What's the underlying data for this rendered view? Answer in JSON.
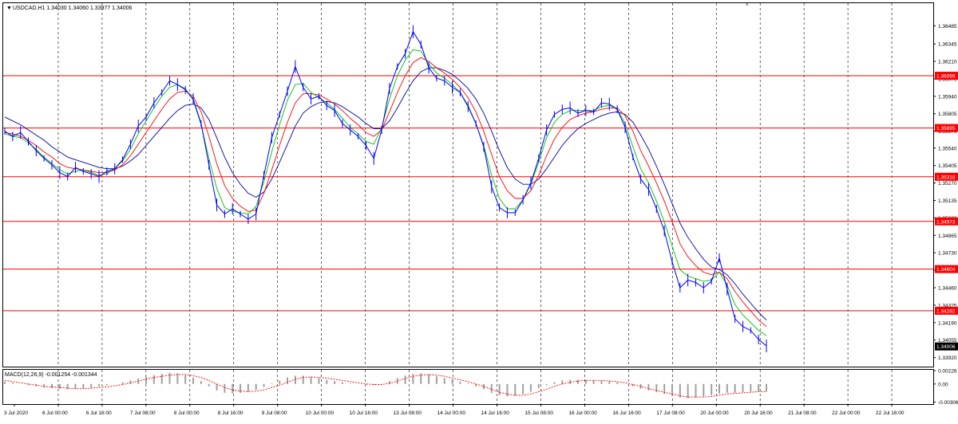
{
  "header": {
    "symbol_line": "USDCAD,H1  1.34030 1.34060 1.33977 1.34006",
    "indicator_label": "MACD(12,26,9) -0.001254 -0.001344"
  },
  "colors": {
    "price": "#0000ff",
    "ma_fast": "#00c000",
    "ma_mid": "#ff0000",
    "ma_slow": "#0000a0",
    "level_line": "#ff0000",
    "level_tag": "#ff0000",
    "current_tag": "#000000",
    "grid": "#000000",
    "macd_hist": "#a0a0a0",
    "macd_signal": "#ff0000"
  },
  "chart_data": [
    {
      "type": "line",
      "name_hint": "price",
      "ylim": [
        1.3385,
        1.3666
      ],
      "y_ticks": [
        1.36485,
        1.36345,
        1.3621,
        1.36075,
        1.3594,
        1.35805,
        1.3567,
        1.3554,
        1.35405,
        1.3527,
        1.35135,
        1.35,
        1.34865,
        1.3473,
        1.34595,
        1.3446,
        1.34325,
        1.3419,
        1.34055,
        1.3392
      ],
      "y_tick_labels": [
        "1.36485",
        "1.36345",
        "1.36210",
        "1.36075",
        "1.35940",
        "1.35805",
        "1.35670",
        "1.35540",
        "1.35405",
        "1.35270",
        "1.35135",
        "1.35000",
        "1.34865",
        "1.34730",
        "1.34595",
        "1.34460",
        "1.34325",
        "1.34190",
        "1.34055",
        "1.33920"
      ],
      "x_labels": [
        "3 Jul 2020",
        "6 Jul 00:00",
        "6 Jul 16:00",
        "7 Jul 08:00",
        "8 Jul 00:00",
        "8 Jul 16:00",
        "9 Jul 08:00",
        "10 Jul 00:00",
        "10 Jul 16:00",
        "13 Jul 08:00",
        "14 Jul 00:00",
        "14 Jul 16:00",
        "15 Jul 08:00",
        "16 Jul 00:00",
        "16 Jul 16:00",
        "17 Jul 08:00",
        "20 Jul 00:00",
        "20 Jul 16:00",
        "21 Jul 08:00",
        "22 Jul 00:00",
        "22 Jul 16:00"
      ],
      "levels": [
        {
          "value": 1.36099,
          "label": "1.36099"
        },
        {
          "value": 1.35695,
          "label": "1.35695"
        },
        {
          "value": 1.35318,
          "label": "1.35318"
        },
        {
          "value": 1.34973,
          "label": "1.34973"
        },
        {
          "value": 1.34604,
          "label": "1.34604"
        },
        {
          "value": 1.34282,
          "label": "1.34282"
        }
      ],
      "current_price": {
        "value": 1.34006,
        "label": "1.34006"
      },
      "price_series": [
        1.3567,
        1.3563,
        1.3566,
        1.3559,
        1.3552,
        1.3546,
        1.3541,
        1.3535,
        1.3532,
        1.3539,
        1.3536,
        1.3534,
        1.3532,
        1.3536,
        1.3538,
        1.3545,
        1.3557,
        1.3571,
        1.3578,
        1.3589,
        1.3597,
        1.3606,
        1.3603,
        1.3599,
        1.3592,
        1.3573,
        1.3541,
        1.351,
        1.3503,
        1.3507,
        1.3503,
        1.3499,
        1.3503,
        1.3533,
        1.3562,
        1.358,
        1.3598,
        1.3617,
        1.3601,
        1.3592,
        1.3594,
        1.3587,
        1.3583,
        1.3573,
        1.3568,
        1.3563,
        1.3556,
        1.3546,
        1.3568,
        1.36,
        1.3617,
        1.3627,
        1.3644,
        1.3634,
        1.3616,
        1.3608,
        1.3606,
        1.3601,
        1.3597,
        1.3586,
        1.3573,
        1.3555,
        1.3524,
        1.3508,
        1.3504,
        1.3504,
        1.3514,
        1.3527,
        1.3546,
        1.3568,
        1.358,
        1.3584,
        1.3585,
        1.3581,
        1.3583,
        1.3582,
        1.3589,
        1.3588,
        1.3584,
        1.357,
        1.3547,
        1.353,
        1.3522,
        1.3507,
        1.349,
        1.3466,
        1.3446,
        1.3452,
        1.345,
        1.3446,
        1.3451,
        1.3469,
        1.3445,
        1.3422,
        1.3416,
        1.3413,
        1.3406,
        1.3401
      ],
      "ma_fast_series": [
        1.3565,
        1.3563,
        1.3562,
        1.3558,
        1.3553,
        1.3547,
        1.3542,
        1.3537,
        1.3534,
        1.3536,
        1.3537,
        1.3535,
        1.3533,
        1.3534,
        1.3538,
        1.3544,
        1.3553,
        1.3565,
        1.3575,
        1.3585,
        1.3594,
        1.3601,
        1.3603,
        1.36,
        1.3591,
        1.3572,
        1.3546,
        1.3523,
        1.3508,
        1.3505,
        1.3504,
        1.3503,
        1.3509,
        1.3528,
        1.3551,
        1.3572,
        1.3591,
        1.3603,
        1.3604,
        1.3597,
        1.3593,
        1.3589,
        1.3584,
        1.3577,
        1.357,
        1.3565,
        1.3559,
        1.3557,
        1.357,
        1.3592,
        1.361,
        1.3622,
        1.363,
        1.3629,
        1.3619,
        1.3612,
        1.3608,
        1.3603,
        1.3597,
        1.3587,
        1.3573,
        1.3556,
        1.3533,
        1.3515,
        1.3507,
        1.3507,
        1.3514,
        1.3526,
        1.3543,
        1.3562,
        1.3574,
        1.358,
        1.3583,
        1.3583,
        1.3583,
        1.3583,
        1.3586,
        1.3587,
        1.3584,
        1.3573,
        1.3555,
        1.3538,
        1.3527,
        1.3513,
        1.3497,
        1.3478,
        1.346,
        1.3455,
        1.3453,
        1.3451,
        1.3452,
        1.3458,
        1.3448,
        1.3433,
        1.3425,
        1.3419,
        1.3413,
        1.3409
      ],
      "ma_mid_series": [
        1.3566,
        1.3565,
        1.3563,
        1.356,
        1.3556,
        1.3551,
        1.3547,
        1.3542,
        1.3539,
        1.3538,
        1.3537,
        1.3536,
        1.3535,
        1.3535,
        1.3537,
        1.3541,
        1.3548,
        1.3557,
        1.3566,
        1.3575,
        1.3584,
        1.3592,
        1.3597,
        1.3598,
        1.3594,
        1.3582,
        1.3563,
        1.3542,
        1.3525,
        1.3515,
        1.3509,
        1.3505,
        1.3506,
        1.3519,
        1.3537,
        1.3556,
        1.3574,
        1.3589,
        1.3596,
        1.3596,
        1.3595,
        1.3592,
        1.3588,
        1.3583,
        1.3577,
        1.3572,
        1.3566,
        1.3563,
        1.3568,
        1.3582,
        1.3597,
        1.361,
        1.362,
        1.3624,
        1.3621,
        1.3616,
        1.3612,
        1.3607,
        1.3601,
        1.3593,
        1.3582,
        1.3567,
        1.3549,
        1.3532,
        1.3521,
        1.3515,
        1.3515,
        1.3521,
        1.3533,
        1.3548,
        1.3561,
        1.357,
        1.3576,
        1.3579,
        1.3581,
        1.3582,
        1.3584,
        1.3585,
        1.3585,
        1.3579,
        1.3567,
        1.3552,
        1.354,
        1.3527,
        1.3513,
        1.3497,
        1.348,
        1.347,
        1.3463,
        1.3458,
        1.3456,
        1.3458,
        1.3453,
        1.3443,
        1.3435,
        1.3428,
        1.3421,
        1.3416
      ],
      "ma_slow_series": [
        1.3578,
        1.3575,
        1.3572,
        1.3568,
        1.3564,
        1.356,
        1.3555,
        1.3551,
        1.3547,
        1.3545,
        1.3543,
        1.3541,
        1.3539,
        1.3538,
        1.3538,
        1.354,
        1.3544,
        1.3549,
        1.3556,
        1.3563,
        1.357,
        1.3577,
        1.3583,
        1.3587,
        1.3588,
        1.3585,
        1.3576,
        1.3562,
        1.3547,
        1.3535,
        1.3526,
        1.3519,
        1.3516,
        1.352,
        1.353,
        1.3543,
        1.3557,
        1.3571,
        1.3581,
        1.3586,
        1.3589,
        1.359,
        1.3589,
        1.3586,
        1.3582,
        1.3578,
        1.3573,
        1.3569,
        1.3569,
        1.3575,
        1.3585,
        1.3596,
        1.3606,
        1.3613,
        1.3616,
        1.3616,
        1.3614,
        1.3611,
        1.3606,
        1.36,
        1.3592,
        1.3581,
        1.3567,
        1.3552,
        1.3539,
        1.353,
        1.3526,
        1.3526,
        1.353,
        1.3538,
        1.3547,
        1.3556,
        1.3563,
        1.3569,
        1.3573,
        1.3576,
        1.3579,
        1.3581,
        1.3582,
        1.358,
        1.3574,
        1.3564,
        1.3553,
        1.354,
        1.3526,
        1.3511,
        1.3496,
        1.3485,
        1.3476,
        1.3468,
        1.3462,
        1.346,
        1.3456,
        1.3449,
        1.3441,
        1.3434,
        1.3427,
        1.3421
      ]
    },
    {
      "type": "bar",
      "name_hint": "MACD",
      "ylim": [
        -0.0034,
        0.0024
      ],
      "y_ticks": [
        0.00226,
        0.0,
        -0.00306
      ],
      "y_tick_labels": [
        "0.00226",
        "0.00",
        "-0.00306"
      ],
      "hist_series": [
        0.0004,
        0.0002,
        0.0,
        -0.0002,
        -0.0004,
        -0.0006,
        -0.0007,
        -0.0008,
        -0.0009,
        -0.0008,
        -0.0007,
        -0.0006,
        -0.0004,
        -0.0002,
        0.0,
        0.0003,
        0.0006,
        0.0009,
        0.0012,
        0.0015,
        0.0017,
        0.0019,
        0.0018,
        0.0015,
        0.0011,
        0.0005,
        -0.0004,
        -0.0011,
        -0.0015,
        -0.0016,
        -0.0015,
        -0.0013,
        -0.001,
        -0.0005,
        0.0001,
        0.0006,
        0.0011,
        0.0014,
        0.0014,
        0.0012,
        0.001,
        0.0007,
        0.0005,
        0.0003,
        0.0001,
        0.0,
        -0.0002,
        -0.0002,
        0.0,
        0.0005,
        0.001,
        0.0014,
        0.0017,
        0.0018,
        0.0016,
        0.0013,
        0.001,
        0.0007,
        0.0004,
        0.0001,
        -0.0004,
        -0.0009,
        -0.0015,
        -0.0019,
        -0.0021,
        -0.002,
        -0.0017,
        -0.0013,
        -0.0007,
        -0.0002,
        0.0003,
        0.0006,
        0.0007,
        0.0007,
        0.0007,
        0.0006,
        0.0006,
        0.0005,
        0.0003,
        0.0,
        -0.0004,
        -0.0008,
        -0.0011,
        -0.0014,
        -0.0017,
        -0.002,
        -0.0023,
        -0.0024,
        -0.0023,
        -0.0021,
        -0.0019,
        -0.0016,
        -0.0015,
        -0.0015,
        -0.0014,
        -0.0013,
        -0.0013,
        -0.0013
      ],
      "signal_series": [
        0.0006,
        0.0004,
        0.0002,
        0.0,
        -0.0002,
        -0.0004,
        -0.0005,
        -0.0006,
        -0.0007,
        -0.0008,
        -0.0008,
        -0.0007,
        -0.0006,
        -0.0005,
        -0.0003,
        -0.0001,
        0.0002,
        0.0005,
        0.0008,
        0.0011,
        0.0013,
        0.0015,
        0.0016,
        0.0016,
        0.0014,
        0.0011,
        0.0006,
        0.0,
        -0.0006,
        -0.001,
        -0.0012,
        -0.0013,
        -0.0012,
        -0.001,
        -0.0006,
        -0.0002,
        0.0003,
        0.0008,
        0.0011,
        0.0012,
        0.0011,
        0.001,
        0.0008,
        0.0006,
        0.0004,
        0.0002,
        0.0,
        -0.0001,
        -0.0001,
        0.0001,
        0.0005,
        0.0009,
        0.0013,
        0.0015,
        0.0016,
        0.0015,
        0.0013,
        0.001,
        0.0007,
        0.0004,
        0.0,
        -0.0004,
        -0.0009,
        -0.0014,
        -0.0017,
        -0.0019,
        -0.0019,
        -0.0017,
        -0.0013,
        -0.0009,
        -0.0004,
        0.0,
        0.0003,
        0.0005,
        0.0006,
        0.0006,
        0.0006,
        0.0005,
        0.0004,
        0.0002,
        -0.0001,
        -0.0004,
        -0.0008,
        -0.0011,
        -0.0014,
        -0.0017,
        -0.002,
        -0.0022,
        -0.0022,
        -0.0022,
        -0.0021,
        -0.0019,
        -0.0017,
        -0.0016,
        -0.0015,
        -0.0014,
        -0.0013,
        -0.0013
      ]
    }
  ]
}
